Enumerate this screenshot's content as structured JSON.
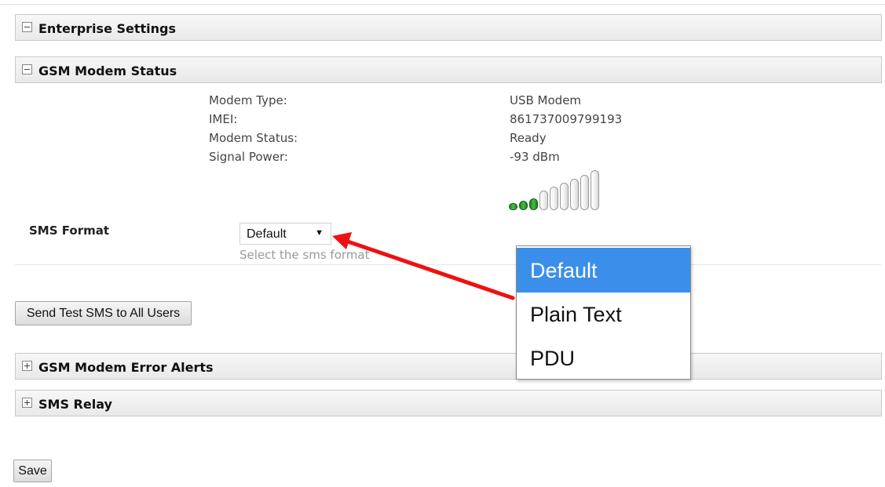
{
  "sections": {
    "enterprise": {
      "title": "Enterprise Settings",
      "toggle": "minus-icon"
    },
    "gsm_status": {
      "title": "GSM Modem Status",
      "toggle": "minus-icon"
    },
    "error_alerts": {
      "title": "GSM Modem Error Alerts",
      "toggle": "plus-icon"
    },
    "sms_relay": {
      "title": "SMS Relay",
      "toggle": "plus-icon"
    }
  },
  "modem": {
    "type_label": "Modem Type:",
    "type_value": "USB Modem",
    "imei_label": "IMEI:",
    "imei_value": "861737009799193",
    "status_label": "Modem Status:",
    "status_value": "Ready",
    "signal_label": "Signal Power:",
    "signal_value": "-93 dBm",
    "signal_bars_lit": 3,
    "signal_bars_total": 9
  },
  "sms_format": {
    "label": "SMS Format",
    "selected": "Default",
    "hint": "Select the sms format",
    "options": [
      "Default",
      "Plain Text",
      "PDU"
    ]
  },
  "buttons": {
    "send_test": "Send Test SMS to All Users",
    "save": "Save"
  },
  "colors": {
    "dropdown_selected": "#3b8eea",
    "signal_on": "#2e9b2e",
    "annotation_arrow": "#ee1111"
  }
}
